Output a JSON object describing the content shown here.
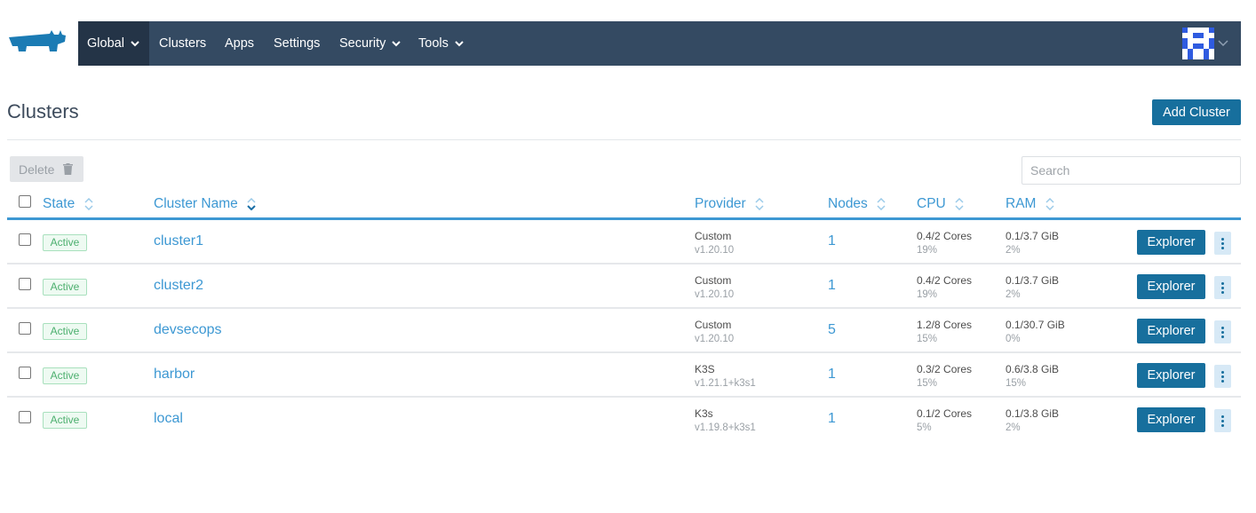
{
  "nav": {
    "items": [
      "Global",
      "Clusters",
      "Apps",
      "Settings",
      "Security",
      "Tools"
    ]
  },
  "page": {
    "title": "Clusters",
    "add_button": "Add Cluster"
  },
  "toolbar": {
    "delete_label": "Delete",
    "search_placeholder": "Search"
  },
  "table": {
    "columns": [
      "State",
      "Cluster Name",
      "Provider",
      "Nodes",
      "CPU",
      "RAM"
    ],
    "explorer_label": "Explorer",
    "rows": [
      {
        "state": "Active",
        "name": "cluster1",
        "provider": "Custom",
        "version": "v1.20.10",
        "nodes": "1",
        "cpu": "0.4/2 Cores",
        "cpu_pct": "19%",
        "ram": "0.1/3.7 GiB",
        "ram_pct": "2%"
      },
      {
        "state": "Active",
        "name": "cluster2",
        "provider": "Custom",
        "version": "v1.20.10",
        "nodes": "1",
        "cpu": "0.4/2 Cores",
        "cpu_pct": "19%",
        "ram": "0.1/3.7 GiB",
        "ram_pct": "2%"
      },
      {
        "state": "Active",
        "name": "devsecops",
        "provider": "Custom",
        "version": "v1.20.10",
        "nodes": "5",
        "cpu": "1.2/8 Cores",
        "cpu_pct": "15%",
        "ram": "0.1/30.7 GiB",
        "ram_pct": "0%"
      },
      {
        "state": "Active",
        "name": "harbor",
        "provider": "K3S",
        "version": "v1.21.1+k3s1",
        "nodes": "1",
        "cpu": "0.3/2 Cores",
        "cpu_pct": "15%",
        "ram": "0.6/3.8 GiB",
        "ram_pct": "15%"
      },
      {
        "state": "Active",
        "name": "local",
        "provider": "K3s",
        "version": "v1.19.8+k3s1",
        "nodes": "1",
        "cpu": "0.1/2 Cores",
        "cpu_pct": "5%",
        "ram": "0.1/3.8 GiB",
        "ram_pct": "2%"
      }
    ]
  },
  "colors": {
    "nav_bg": "#344a62",
    "nav_active": "#243447",
    "accent": "#3d98d3",
    "button": "#176f9d",
    "active_green": "#4caf6e"
  }
}
